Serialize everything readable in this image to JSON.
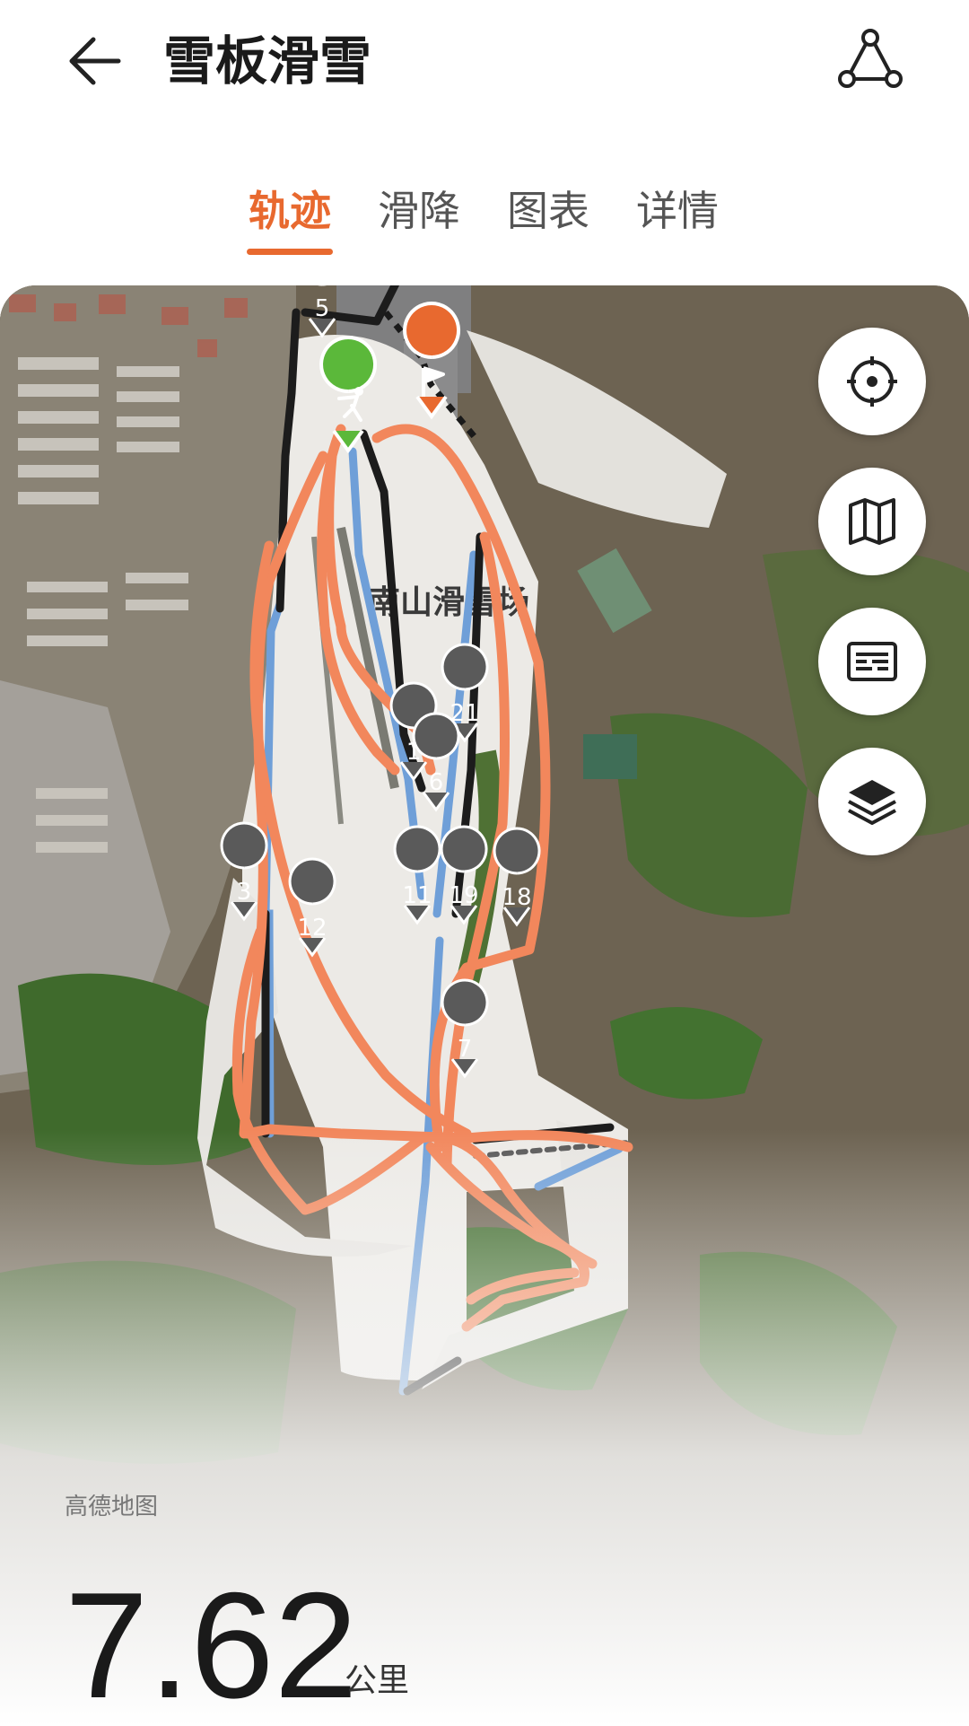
{
  "header": {
    "title": "雪板滑雪"
  },
  "tabs": [
    {
      "label": "轨迹",
      "active": true
    },
    {
      "label": "滑降",
      "active": false
    },
    {
      "label": "图表",
      "active": false
    },
    {
      "label": "详情",
      "active": false
    }
  ],
  "map": {
    "place_label": "南山滑雪场",
    "provider": "高德地图",
    "markers": [
      "5",
      "21",
      "1",
      "6",
      "3",
      "12",
      "11",
      "19",
      "18",
      "7"
    ],
    "side_buttons": [
      "locate-icon",
      "map-icon",
      "legend-icon",
      "layers-icon"
    ],
    "colors": {
      "track_orange": "#f2875c",
      "lift_blue": "#6f9fd8",
      "walk_black": "#1c1c1c",
      "accent": "#e8692f",
      "start_green": "#5bb83a"
    }
  },
  "summary": {
    "distance": "7.62",
    "unit": "公里"
  }
}
